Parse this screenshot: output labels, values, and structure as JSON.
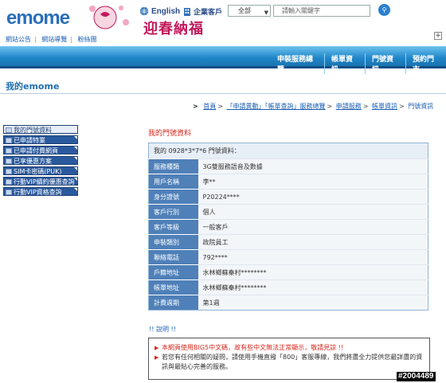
{
  "header": {
    "logo": "emome",
    "deco_text": "迎春納福",
    "lang_label": "English",
    "biz_label": "企業客戶",
    "search": {
      "category": "全部",
      "placeholder": "請輸入關鍵字"
    },
    "top_links": [
      "網站公告",
      "網站導覽",
      "粉絲團"
    ]
  },
  "nav": {
    "items": [
      "申裝服務總覽",
      "帳單資訊",
      "門號資訊",
      "預約門市"
    ]
  },
  "page_title": "我的emome",
  "breadcrumb": {
    "items": [
      "首頁",
      "「申請異動」「帳單查詢」服務總覽",
      "申請服務",
      "帳單資訊"
    ],
    "current": "門號資訊"
  },
  "sidebar": {
    "items": [
      "我的門號資料",
      "已申請特業",
      "已申請付費網頁",
      "已享優惠方案",
      "SIM卡密碼(PUK)",
      "行動VIP續約優惠查詢",
      "行動VIP資格查詢"
    ]
  },
  "main": {
    "section_title": "我的門號資料",
    "table_header": "我的 0928*3*7*6 門號資料：",
    "rows": [
      {
        "label": "服務種類",
        "value": "3G雙服務語音及數據"
      },
      {
        "label": "用戶名稱",
        "value": "李**"
      },
      {
        "label": "身分證號",
        "value": "P20224****"
      },
      {
        "label": "客戶行別",
        "value": "個人"
      },
      {
        "label": "客戶等級",
        "value": "一般客戶"
      },
      {
        "label": "申裝類別",
        "value": "政院員工"
      },
      {
        "label": "聯絡電話",
        "value": "792****"
      },
      {
        "label": "戶籍地址",
        "value": "水林鄉蘇秦村********"
      },
      {
        "label": "帳單地址",
        "value": "水林鄉蘇秦村********"
      },
      {
        "label": "計費週期",
        "value": "第1週"
      }
    ]
  },
  "notice": {
    "label": "說明",
    "lines": [
      "本網頁使用BIG5中文碼，故有些中文無法正常顯示，敬請見諒 !!",
      "若您有任何相關的疑問，請使用手機直撥「800」客服專線，我們將盡全力提供您最詳盡的資",
      "訊與最貼心完善的服務。"
    ]
  },
  "watermark": "#2004489",
  "colors": {
    "brand_blue": "#1f86c8",
    "accent_red": "#d62a1e",
    "table_label": "#4f80b8"
  }
}
